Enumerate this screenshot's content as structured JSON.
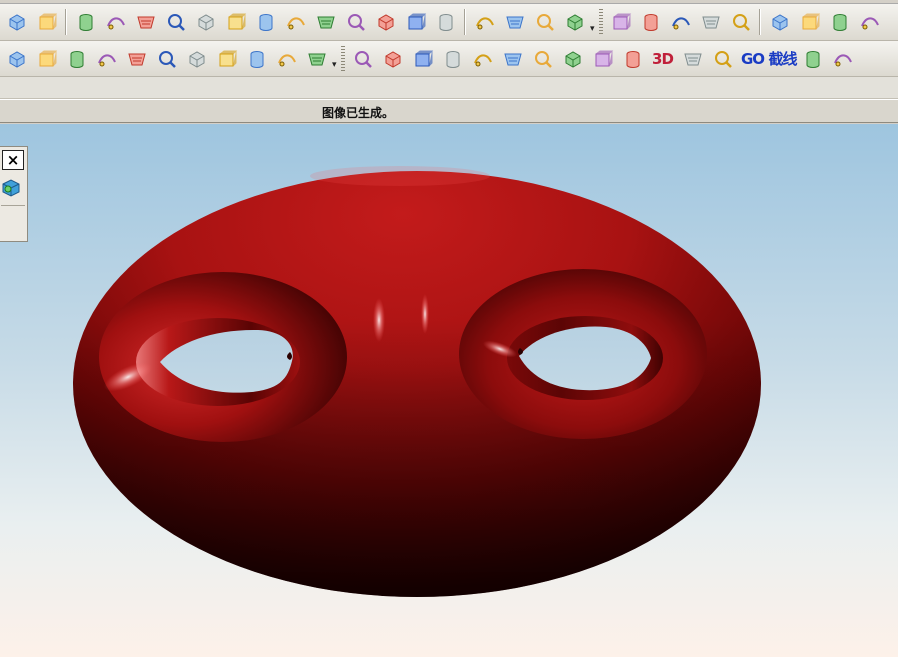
{
  "status": {
    "message": "图像已生成。"
  },
  "toolbar_row_1": [
    {
      "name": "view-fit-icon"
    },
    {
      "name": "view-shade-icon"
    },
    "sep",
    {
      "name": "sketch-plane-icon"
    },
    {
      "name": "box-icon"
    },
    {
      "name": "section-view-icon"
    },
    {
      "name": "block-cut-icon"
    },
    {
      "name": "cube-hole-icon"
    },
    {
      "name": "tube-icon"
    },
    {
      "name": "cylinder-icon"
    },
    {
      "name": "sphere-icon"
    },
    {
      "name": "block-blue-icon"
    },
    {
      "name": "pad-icon"
    },
    {
      "name": "block-red-icon"
    },
    {
      "name": "boss-icon"
    },
    {
      "name": "offset-face-icon"
    },
    "sep",
    {
      "name": "thread-icon"
    },
    {
      "name": "extrude-icon"
    },
    {
      "name": "sheet-icon"
    },
    {
      "name": "pattern-icon"
    },
    "more",
    "grip",
    {
      "name": "surface-grid-icon"
    },
    {
      "name": "surface-mesh-icon"
    },
    {
      "name": "sweep-icon"
    },
    {
      "name": "ribbon-icon"
    },
    {
      "name": "surface-inspect-icon"
    },
    "sep",
    {
      "name": "face-blend-icon"
    },
    {
      "name": "trim-body-icon"
    },
    {
      "name": "loft-icon"
    },
    {
      "name": "rule-surface-icon"
    }
  ],
  "toolbar_row_2": [
    {
      "name": "feature-icon"
    },
    {
      "name": "part-cube-icon"
    },
    {
      "name": "shell-icon"
    },
    {
      "name": "book-icon"
    },
    {
      "name": "chamfer-icon"
    },
    {
      "name": "emboss-icon"
    },
    {
      "name": "unite-icon"
    },
    {
      "name": "subtract-icon"
    },
    {
      "name": "trim-icon"
    },
    {
      "name": "box-edge-icon"
    },
    {
      "name": "paint-icon"
    },
    "more",
    "grip",
    {
      "name": "zoom-curve-icon"
    },
    {
      "name": "probe-icon"
    },
    {
      "name": "curve-arrow-icon"
    },
    {
      "name": "cross-line-icon"
    },
    {
      "name": "s-curve-icon"
    },
    {
      "name": "corner-line-icon"
    },
    {
      "name": "page-curve-icon"
    },
    {
      "name": "hook-curve-icon"
    },
    {
      "name": "arc-icon"
    },
    {
      "name": "bridge-curve-icon"
    },
    {
      "name": "text-3d-icon",
      "text": "3D"
    },
    {
      "name": "helix-icon"
    },
    {
      "name": "spline-icon"
    },
    {
      "name": "go-icon",
      "text": "GO"
    },
    {
      "name": "section-curve-icon",
      "text": "截线"
    },
    {
      "name": "hatch-icon"
    },
    {
      "name": "red-dial-icon"
    }
  ],
  "colors": {
    "model_red": "#b01414",
    "model_dark": "#1a0000",
    "sky_top": "#9ec5df",
    "floor": "#fdf1e9",
    "accent_blue": "#2b58b8",
    "accent_yellow": "#f2c94c"
  }
}
